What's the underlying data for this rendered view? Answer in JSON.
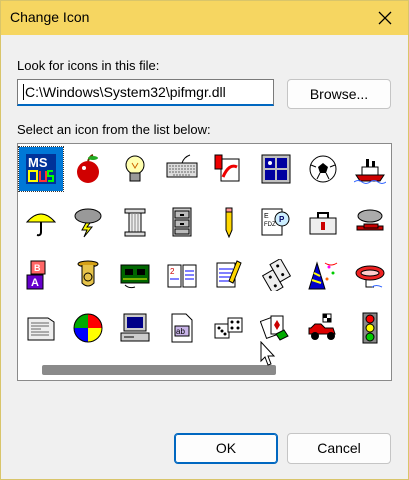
{
  "dialog": {
    "title": "Change Icon",
    "close_label": "Close",
    "file_label": "Look for icons in this file:",
    "file_path": "C:\\Windows\\System32\\pifmgr.dll",
    "browse_label": "Browse...",
    "list_label": "Select an icon from the list below:",
    "ok_label": "OK",
    "cancel_label": "Cancel"
  },
  "icons": [
    {
      "name": "ms-dos-icon",
      "selected": true
    },
    {
      "name": "apple-icon"
    },
    {
      "name": "light-bulb-icon"
    },
    {
      "name": "keyboard-icon"
    },
    {
      "name": "paint-tube-icon"
    },
    {
      "name": "window-icon"
    },
    {
      "name": "soccer-ball-icon"
    },
    {
      "name": "ship-icon"
    },
    {
      "name": "umbrella-icon"
    },
    {
      "name": "storm-cloud-icon"
    },
    {
      "name": "column-icon"
    },
    {
      "name": "file-cabinet-icon"
    },
    {
      "name": "pencil-icon"
    },
    {
      "name": "eye-chart-icon"
    },
    {
      "name": "doctor-bag-icon"
    },
    {
      "name": "biplane-icon"
    },
    {
      "name": "toy-blocks-icon"
    },
    {
      "name": "tuba-icon"
    },
    {
      "name": "circuit-board-icon"
    },
    {
      "name": "open-book-icon"
    },
    {
      "name": "notepad-pencil-icon"
    },
    {
      "name": "dominoes-icon"
    },
    {
      "name": "party-hat-icon"
    },
    {
      "name": "raft-icon"
    },
    {
      "name": "newspaper-icon"
    },
    {
      "name": "beach-ball-icon"
    },
    {
      "name": "computer-icon"
    },
    {
      "name": "ab-document-icon"
    },
    {
      "name": "dice-icon"
    },
    {
      "name": "playing-cards-icon"
    },
    {
      "name": "race-car-icon"
    },
    {
      "name": "traffic-light-icon"
    }
  ],
  "colors": {
    "titlebar": "#f6d661",
    "accent": "#0067c0",
    "selection": "#0078d7"
  }
}
